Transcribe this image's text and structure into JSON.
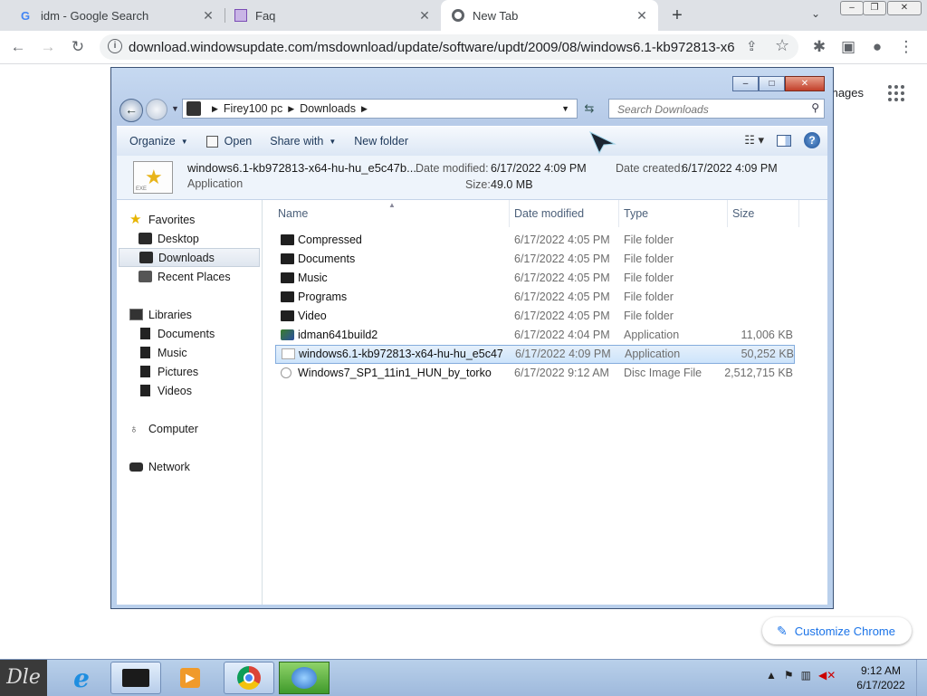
{
  "browser": {
    "tabs": [
      {
        "title": "idm - Google Search",
        "favicon": "google-icon"
      },
      {
        "title": "Faq",
        "favicon": "faq-icon"
      },
      {
        "title": "New Tab",
        "favicon": "chrome-icon"
      }
    ],
    "url": "download.windowsupdate.com/msdownload/update/software/updt/2009/08/windows6.1-kb972813-x64-h..."
  },
  "google": {
    "images_link": "mages",
    "customize_label": "Customize Chrome"
  },
  "explorer": {
    "breadcrumb": [
      "Firey100 pc",
      "Downloads"
    ],
    "search_placeholder": "Search Downloads",
    "commands": {
      "organize": "Organize",
      "open": "Open",
      "share_with": "Share with",
      "new_folder": "New folder"
    },
    "details": {
      "name": "windows6.1-kb972813-x64-hu-hu_e5c47b...",
      "type": "Application",
      "date_modified_label": "Date modified:",
      "date_modified": "6/17/2022 4:09 PM",
      "date_created_label": "Date created:",
      "date_created": "6/17/2022 4:09 PM",
      "size_label": "Size:",
      "size": "49.0 MB"
    },
    "nav": {
      "favorites": "Favorites",
      "desktop": "Desktop",
      "downloads": "Downloads",
      "recent": "Recent Places",
      "libraries": "Libraries",
      "documents": "Documents",
      "music": "Music",
      "pictures": "Pictures",
      "videos": "Videos",
      "computer": "Computer",
      "network": "Network"
    },
    "columns": {
      "name": "Name",
      "date": "Date modified",
      "type": "Type",
      "size": "Size"
    },
    "files": [
      {
        "name": "Compressed",
        "date": "6/17/2022 4:05 PM",
        "type": "File folder",
        "size": ""
      },
      {
        "name": "Documents",
        "date": "6/17/2022 4:05 PM",
        "type": "File folder",
        "size": ""
      },
      {
        "name": "Music",
        "date": "6/17/2022 4:05 PM",
        "type": "File folder",
        "size": ""
      },
      {
        "name": "Programs",
        "date": "6/17/2022 4:05 PM",
        "type": "File folder",
        "size": ""
      },
      {
        "name": "Video",
        "date": "6/17/2022 4:05 PM",
        "type": "File folder",
        "size": ""
      },
      {
        "name": "idman641build2",
        "date": "6/17/2022 4:04 PM",
        "type": "Application",
        "size": "11,006 KB"
      },
      {
        "name": "windows6.1-kb972813-x64-hu-hu_e5c47...",
        "date": "6/17/2022 4:09 PM",
        "type": "Application",
        "size": "50,252 KB"
      },
      {
        "name": "Windows7_SP1_11in1_HUN_by_torko",
        "date": "6/17/2022 9:12 AM",
        "type": "Disc Image File",
        "size": "2,512,715 KB"
      }
    ]
  },
  "taskbar": {
    "time": "9:12 AM",
    "date": "6/17/2022"
  }
}
